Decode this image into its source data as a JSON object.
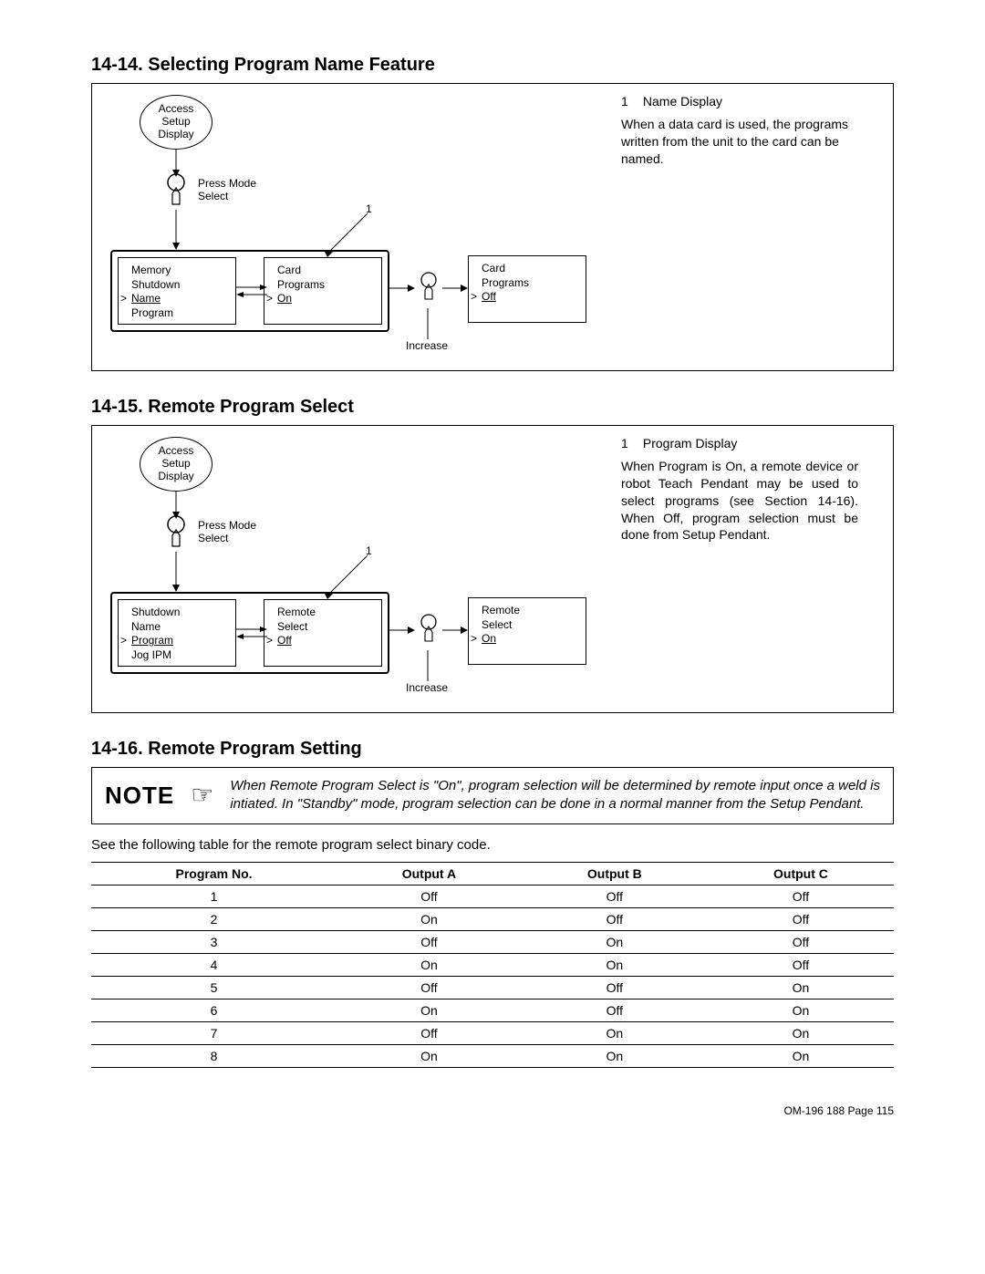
{
  "sections": {
    "s1": {
      "title": "14-14.  Selecting Program Name Feature"
    },
    "s2": {
      "title": "14-15.  Remote Program Select"
    },
    "s3": {
      "title": "14-16.  Remote Program Setting"
    }
  },
  "fig1": {
    "sidenote_num": "1",
    "sidenote_title": "Name Display",
    "sidenote_body": "When a data card is used, the programs written from the unit to the card can be named.",
    "oval_l1": "Access",
    "oval_l2": "Setup",
    "oval_l3": "Display",
    "press_label_l1": "Press Mode",
    "press_label_l2": "Select",
    "callout_num": "1",
    "box1_l1": "Memory",
    "box1_l2": "Shutdown",
    "box1_sel": "Name",
    "box1_l4": "Program",
    "box2_l1": "Card",
    "box2_l2": "Programs",
    "box2_sel": "On",
    "box3_l1": "Card",
    "box3_l2": "Programs",
    "box3_sel": "Off",
    "increase": "Increase"
  },
  "fig2": {
    "sidenote_num": "1",
    "sidenote_title": "Program Display",
    "sidenote_body": "When Program is On, a remote device or robot Teach Pendant may be used to select programs (see Section 14-16). When Off, program selection must be done from Setup Pendant.",
    "oval_l1": "Access",
    "oval_l2": "Setup",
    "oval_l3": "Display",
    "press_label_l1": "Press Mode",
    "press_label_l2": "Select",
    "callout_num": "1",
    "box1_l1": "Shutdown",
    "box1_l2": "Name",
    "box1_sel": "Program",
    "box1_l4": "Jog IPM",
    "box2_l1": "Remote",
    "box2_l2": "Select",
    "box2_sel": "Off",
    "box3_l1": "Remote",
    "box3_l2": "Select",
    "box3_sel": "On",
    "increase": "Increase"
  },
  "note": {
    "word": "NOTE",
    "text": "When Remote Program Select is \"On\", program selection will be determined by remote input once a weld is intiated. In \"Standby\" mode, program selection can be done in a normal manner from the Setup Pendant."
  },
  "lead": "See the following table for the remote program select binary code.",
  "table": {
    "headers": [
      "Program No.",
      "Output A",
      "Output B",
      "Output C"
    ],
    "rows": [
      [
        "1",
        "Off",
        "Off",
        "Off"
      ],
      [
        "2",
        "On",
        "Off",
        "Off"
      ],
      [
        "3",
        "Off",
        "On",
        "Off"
      ],
      [
        "4",
        "On",
        "On",
        "Off"
      ],
      [
        "5",
        "Off",
        "Off",
        "On"
      ],
      [
        "6",
        "On",
        "Off",
        "On"
      ],
      [
        "7",
        "Off",
        "On",
        "On"
      ],
      [
        "8",
        "On",
        "On",
        "On"
      ]
    ]
  },
  "footer": "OM-196 188 Page 115"
}
